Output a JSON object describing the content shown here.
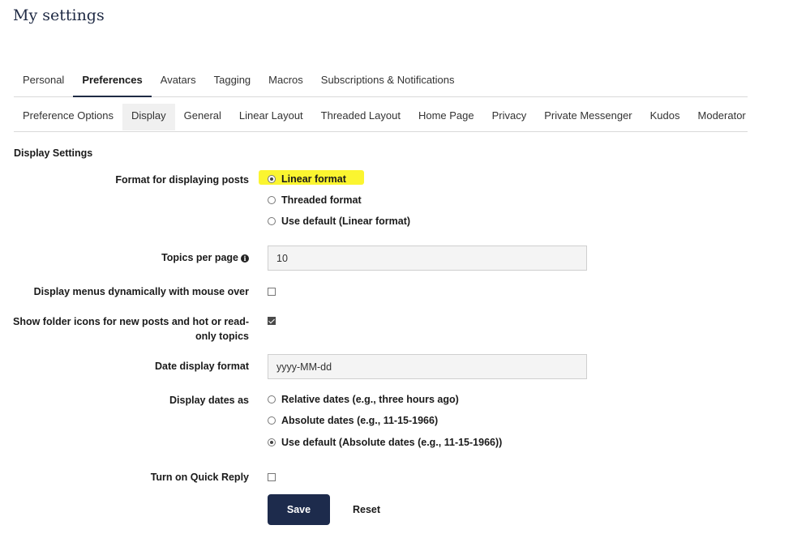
{
  "page": {
    "title": "My settings"
  },
  "primary_tabs": [
    {
      "label": "Personal",
      "active": false
    },
    {
      "label": "Preferences",
      "active": true
    },
    {
      "label": "Avatars",
      "active": false
    },
    {
      "label": "Tagging",
      "active": false
    },
    {
      "label": "Macros",
      "active": false
    },
    {
      "label": "Subscriptions & Notifications",
      "active": false
    }
  ],
  "secondary_tabs": [
    {
      "label": "Preference Options",
      "active": false
    },
    {
      "label": "Display",
      "active": true
    },
    {
      "label": "General",
      "active": false
    },
    {
      "label": "Linear Layout",
      "active": false
    },
    {
      "label": "Threaded Layout",
      "active": false
    },
    {
      "label": "Home Page",
      "active": false
    },
    {
      "label": "Privacy",
      "active": false
    },
    {
      "label": "Private Messenger",
      "active": false
    },
    {
      "label": "Kudos",
      "active": false
    },
    {
      "label": "Moderator",
      "active": false
    }
  ],
  "display_settings": {
    "section_title": "Display Settings",
    "format": {
      "label": "Format for displaying posts",
      "options": [
        "Linear format",
        "Threaded format",
        "Use default (Linear format)"
      ],
      "selected_index": 0
    },
    "topics_per_page": {
      "label": "Topics per page",
      "value": "10",
      "icon": "info-icon"
    },
    "dynamic_menus": {
      "label": "Display menus dynamically with mouse over",
      "checked": false
    },
    "folder_icons": {
      "label_line1": "Show folder icons for new posts and hot or read-",
      "label_line2": "only topics",
      "checked": true
    },
    "date_format": {
      "label": "Date display format",
      "value": "yyyy-MM-dd"
    },
    "dates_as": {
      "label": "Display dates as",
      "options": [
        "Relative dates (e.g., three hours ago)",
        "Absolute dates (e.g., 11-15-1966)",
        "Use default (Absolute dates (e.g., 11-15-1966))"
      ],
      "selected_index": 2
    },
    "quick_reply": {
      "label": "Turn on Quick Reply",
      "checked": false
    }
  },
  "actions": {
    "save_label": "Save",
    "reset_label": "Reset"
  },
  "colors": {
    "highlight": "#fbf530",
    "primary_button": "#1d2b4c"
  }
}
